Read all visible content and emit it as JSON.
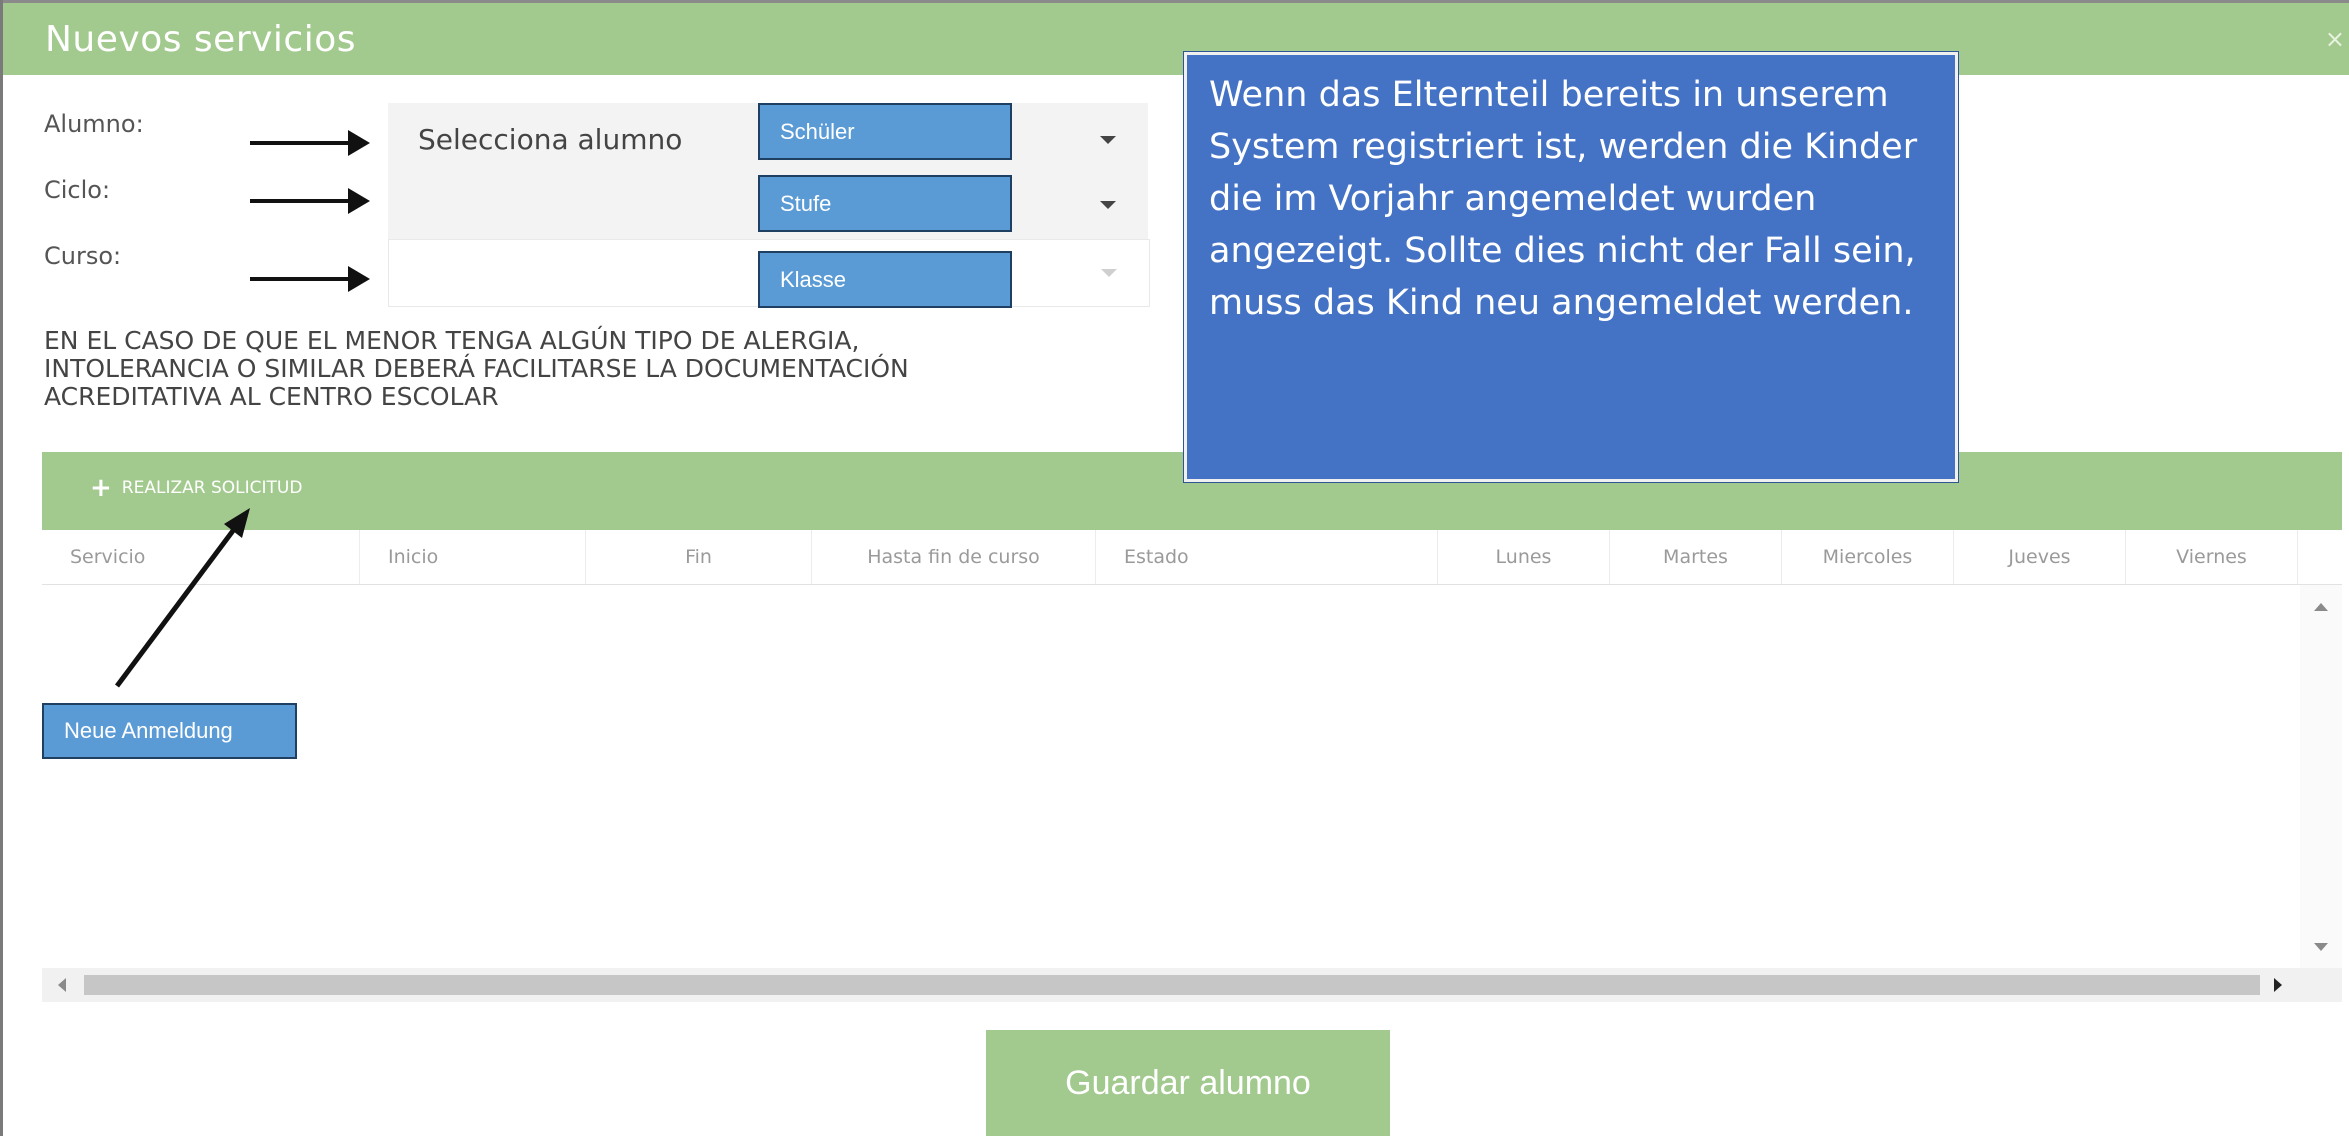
{
  "dialog": {
    "title": "Nuevos servicios",
    "close_glyph": "×"
  },
  "form": {
    "student_label": "Alumno:",
    "cycle_label": "Ciclo:",
    "course_label": "Curso:",
    "student_select_value": "Selecciona alumno",
    "cycle_select_value": "",
    "course_select_value": ""
  },
  "callouts": {
    "student": "Schüler",
    "cycle": "Stufe",
    "course": "Klasse",
    "new_registration": "Neue Anmeldung",
    "info_text": "Wenn das Elternteil bereits in unserem System registriert ist, werden die Kinder die im Vorjahr angemeldet wurden angezeigt. Sollte dies nicht der Fall sein, muss das Kind neu angemeldet werden."
  },
  "warning": {
    "line1": "EN EL CASO DE QUE EL MENOR TENGA ALGÚN TIPO DE ALERGIA,",
    "line2": "INTOLERANCIA O SIMILAR DEBERÁ FACILITARSE LA DOCUMENTACIÓN",
    "line3": "ACREDITATIVA AL CENTRO ESCOLAR"
  },
  "toolbar": {
    "add_icon": "plus-icon",
    "add_label": "REALIZAR SOLICITUD"
  },
  "table": {
    "columns": [
      "Servicio",
      "Inicio",
      "Fin",
      "Hasta fin de curso",
      "Estado",
      "Lunes",
      "Martes",
      "Miercoles",
      "Jueves",
      "Viernes"
    ],
    "rows": []
  },
  "footer": {
    "save_label": "Guardar alumno"
  },
  "colors": {
    "header_green": "#a3ca8e",
    "callout_blue": "#5b9bd5",
    "info_blue": "#4472c4"
  }
}
